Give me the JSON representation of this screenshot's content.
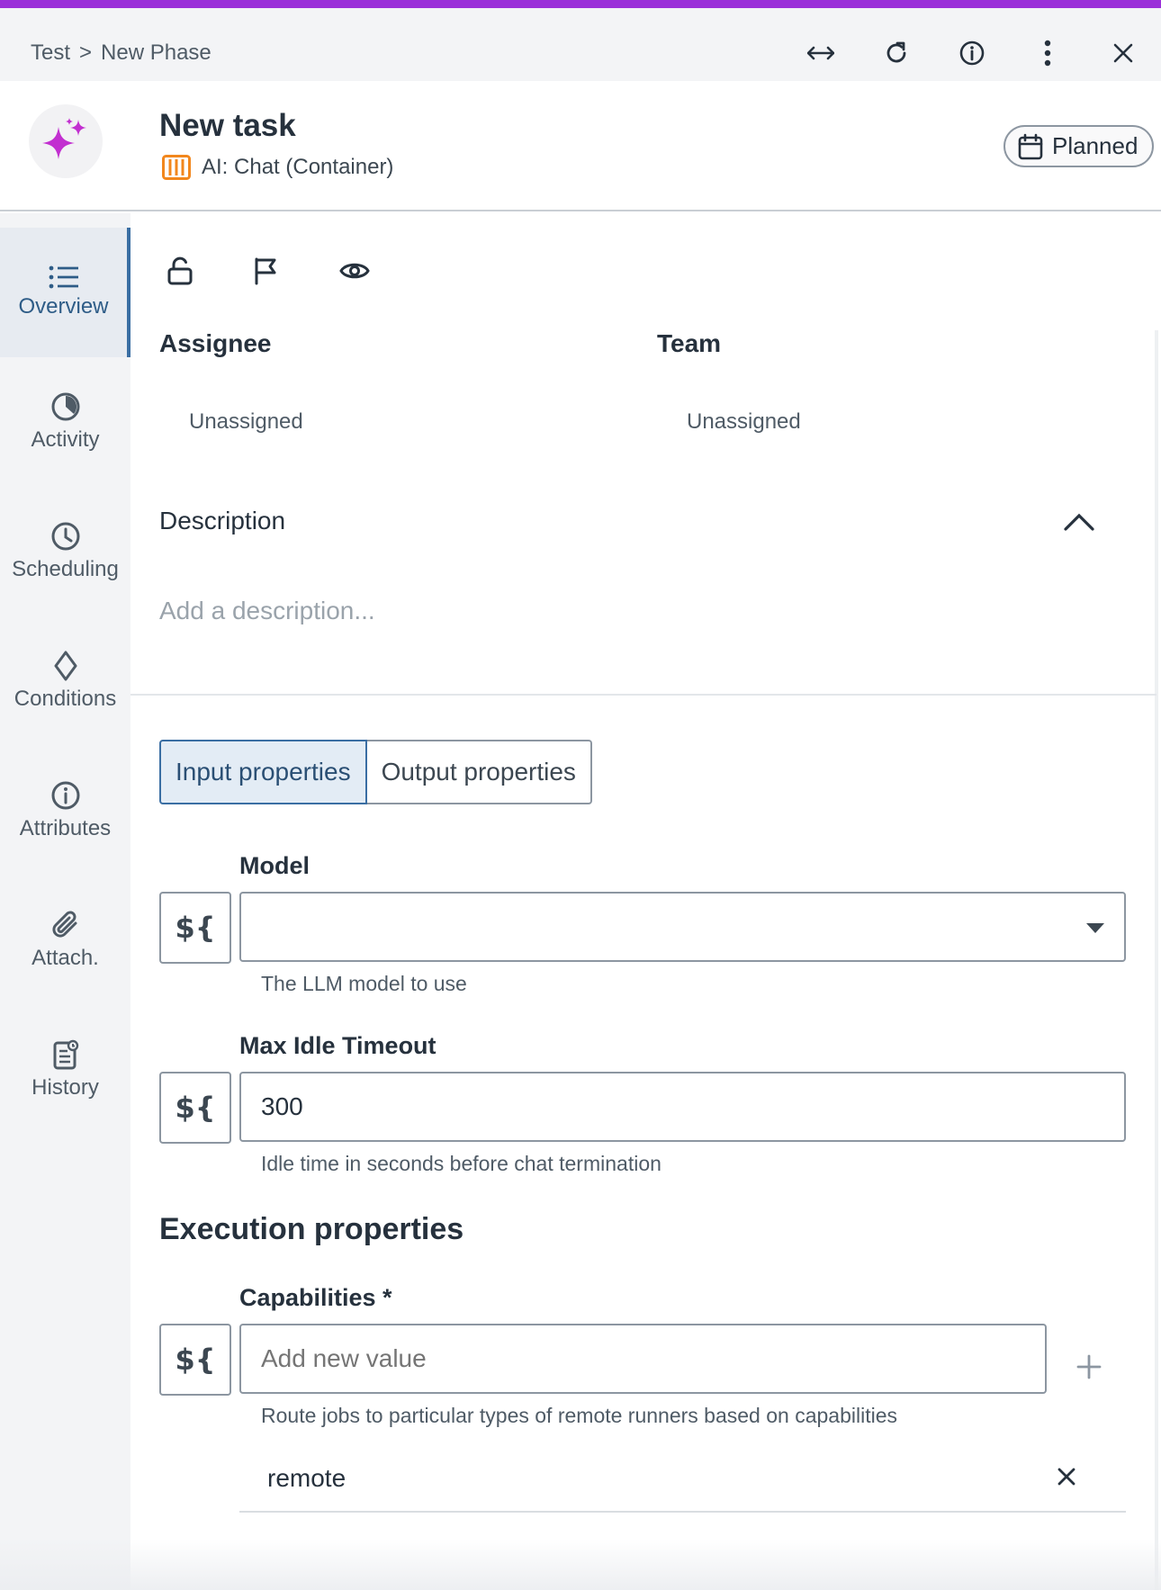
{
  "breadcrumb": {
    "root": "Test",
    "separator": ">",
    "current": "New Phase"
  },
  "topbar": {
    "icons": [
      "expand-horizontal-icon",
      "refresh-icon",
      "info-icon",
      "more-vertical-icon",
      "close-icon"
    ]
  },
  "task": {
    "title": "New task",
    "type_label": "AI: Chat (Container)",
    "status": "Planned"
  },
  "sidebar": {
    "items": [
      {
        "label": "Overview",
        "icon": "list-icon",
        "active": true
      },
      {
        "label": "Activity",
        "icon": "activity-icon",
        "active": false
      },
      {
        "label": "Scheduling",
        "icon": "clock-icon",
        "active": false
      },
      {
        "label": "Conditions",
        "icon": "diamond-icon",
        "active": false
      },
      {
        "label": "Attributes",
        "icon": "info-icon",
        "active": false
      },
      {
        "label": "Attach.",
        "icon": "paperclip-icon",
        "active": false
      },
      {
        "label": "History",
        "icon": "history-icon",
        "active": false
      }
    ]
  },
  "overview": {
    "assignee_label": "Assignee",
    "assignee_value": "Unassigned",
    "team_label": "Team",
    "team_value": "Unassigned",
    "description_label": "Description",
    "description_placeholder": "Add a description..."
  },
  "tabs": {
    "input": "Input properties",
    "output": "Output properties"
  },
  "fields": {
    "expr_symbol": "${",
    "model": {
      "label": "Model",
      "value": "",
      "help": "The LLM model to use"
    },
    "timeout": {
      "label": "Max Idle Timeout",
      "value": "300",
      "help": "Idle time in seconds before chat termination"
    }
  },
  "execution": {
    "title": "Execution properties",
    "capabilities": {
      "label": "Capabilities *",
      "placeholder": "Add new value",
      "help": "Route jobs to particular types of remote runners based on capabilities",
      "values": [
        "remote"
      ]
    }
  },
  "colors": {
    "accent": "#9b30d9",
    "active_blue": "#3a6ea3",
    "task_icon": "#c22fd0",
    "type_icon": "#f2871d"
  }
}
